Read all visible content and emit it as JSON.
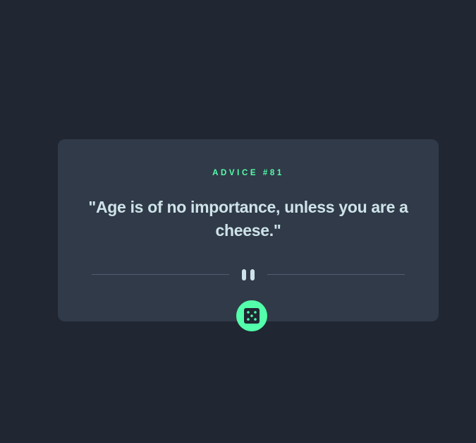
{
  "card": {
    "advice_label": "ADVICE #81",
    "quote": "\"Age is of no importance, unless you are a cheese.\""
  },
  "icons": {
    "divider": "pause-icon",
    "button": "dice-icon"
  },
  "colors": {
    "background": "#202632",
    "card": "#313a48",
    "accent": "#53ffaa",
    "text": "#cee3e9",
    "divider": "#4f5d74"
  }
}
